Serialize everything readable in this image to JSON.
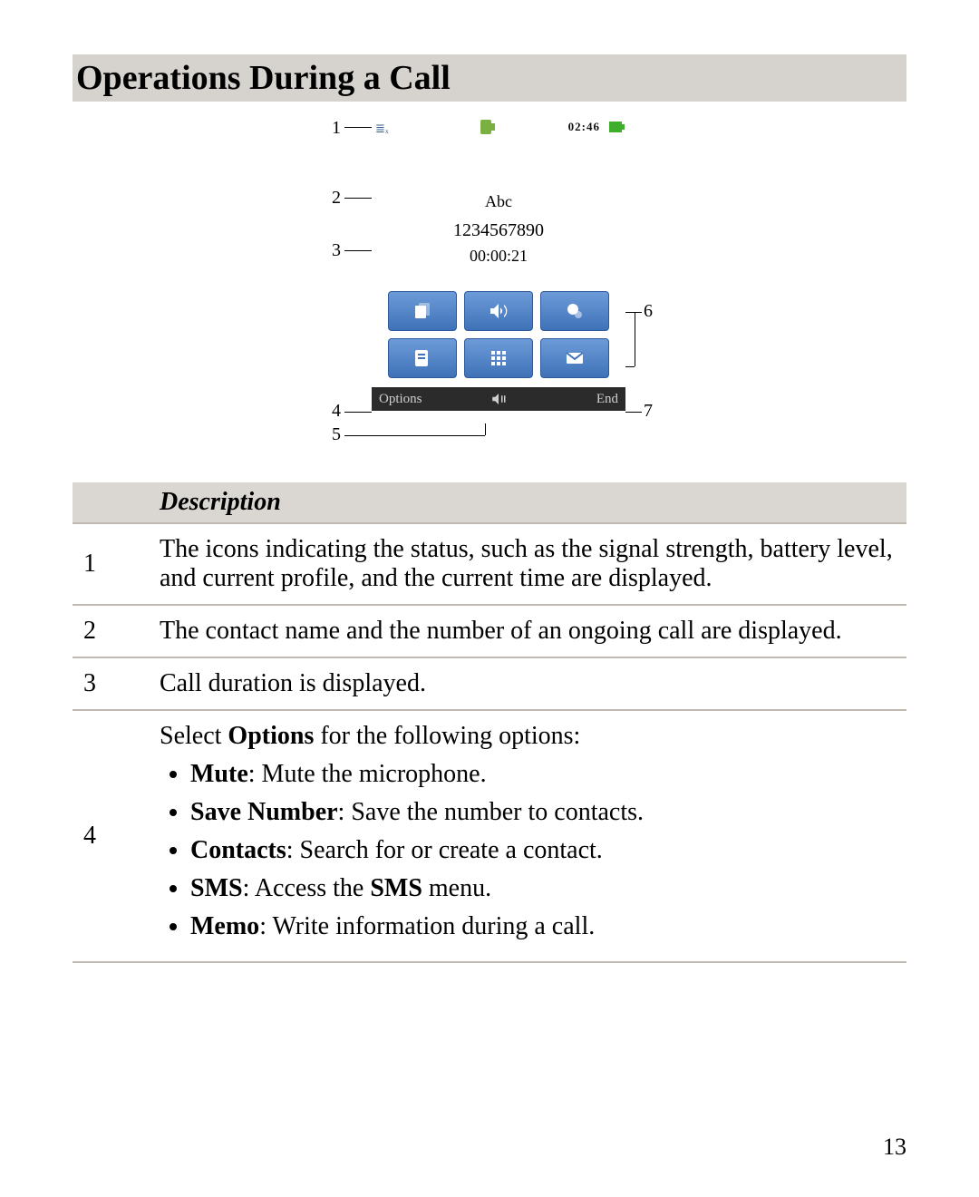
{
  "section_title": "Operations During a Call",
  "phone": {
    "status_time": "02:46",
    "contact_name": "Abc",
    "contact_number": "1234567890",
    "call_duration": "00:00:21",
    "softkey_left": "Options",
    "softkey_right": "End"
  },
  "callouts": {
    "c1": "1",
    "c2": "2",
    "c3": "3",
    "c4": "4",
    "c5": "5",
    "c6": "6",
    "c7": "7"
  },
  "table": {
    "header_blank": "",
    "header_desc": "Description",
    "rows": {
      "r1_num": "1",
      "r1_text": "The icons indicating the status, such as the signal strength, battery level, and current profile, and the current time are displayed.",
      "r2_num": "2",
      "r2_text": "The contact name and the number of an ongoing call are displayed.",
      "r3_num": "3",
      "r3_text": "Call duration is displayed.",
      "r4_num": "4",
      "r4_intro_a": "Select ",
      "r4_intro_b": "Options",
      "r4_intro_c": " for the following options:",
      "opt1_b": "Mute",
      "opt1_t": ": Mute the microphone.",
      "opt2_b": "Save Number",
      "opt2_t": ": Save the number to contacts.",
      "opt3_b": "Contacts",
      "opt3_t": ": Search for or create a contact.",
      "opt4_b": "SMS",
      "opt4_t1": ": Access the ",
      "opt4_t2": "SMS",
      "opt4_t3": " menu.",
      "opt5_b": "Memo",
      "opt5_t": ": Write information during a call."
    }
  },
  "page_number": "13"
}
